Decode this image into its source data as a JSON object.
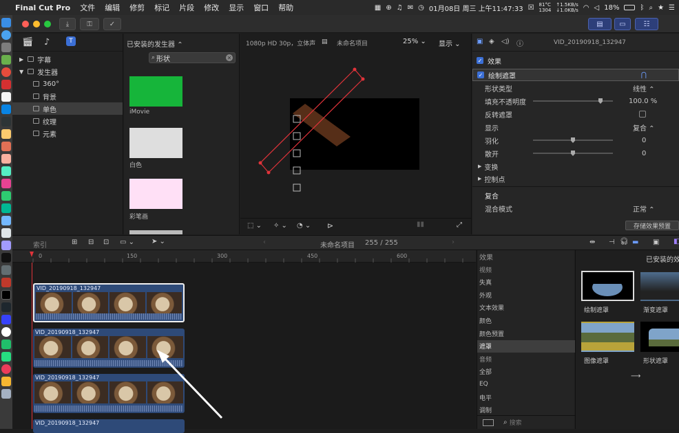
{
  "menubar": {
    "app": "Final Cut Pro",
    "items": [
      "文件",
      "编辑",
      "修剪",
      "标记",
      "片段",
      "修改",
      "显示",
      "窗口",
      "帮助"
    ],
    "datetime": "01月08日 周三 上午11:47:33",
    "temp": "81°C",
    "fan": "1304",
    "net_up": "↑1.5KB/s",
    "net_down": "↓1.0KB/s",
    "battery": "18%"
  },
  "library": {
    "items": [
      {
        "label": "字幕",
        "level": 0
      },
      {
        "label": "发生器",
        "level": 0
      },
      {
        "label": "360°",
        "level": 1
      },
      {
        "label": "背景",
        "level": 1
      },
      {
        "label": "单色",
        "level": 1,
        "selected": true
      },
      {
        "label": "纹理",
        "level": 1
      },
      {
        "label": "元素",
        "level": 1
      }
    ]
  },
  "browser": {
    "title": "已安装的发生器",
    "search_value": "形状",
    "thumbs": [
      {
        "label": "iMovie",
        "color": "#16b53a"
      },
      {
        "label": "白色",
        "color": "#dedede"
      },
      {
        "label": "彩笔画",
        "color": "#ffe0f6"
      }
    ]
  },
  "viewer": {
    "format": "1080p HD 30p，立体声",
    "project": "未命名项目",
    "zoom": "25%",
    "display": "显示"
  },
  "inspector": {
    "clip_name": "VID_20190918_132947",
    "effects_label": "效果",
    "draw_mask": "绘制遮罩",
    "rows": [
      {
        "label": "形状类型",
        "value": "线性"
      },
      {
        "label": "填充不透明度",
        "value": "100.0 %",
        "slider": 0.82
      },
      {
        "label": "反转遮罩",
        "value": ""
      },
      {
        "label": "显示",
        "value": "复合"
      },
      {
        "label": "羽化",
        "value": "0",
        "slider": 0.5
      },
      {
        "label": "散开",
        "value": "0",
        "slider": 0.5
      },
      {
        "label": "变换",
        "value": ""
      },
      {
        "label": "控制点",
        "value": ""
      }
    ],
    "composite_label": "复合",
    "blend_label": "混合模式",
    "blend_value": "正常",
    "save_preset": "存储效果预置"
  },
  "timeline_bar": {
    "index": "索引",
    "project": "未命名项目",
    "counter": "255 / 255"
  },
  "ruler": {
    "ticks": [
      "0",
      "150",
      "300",
      "450",
      "600"
    ]
  },
  "timeline": {
    "clips": [
      {
        "name": "VID_20190918_132947",
        "selected": true
      },
      {
        "name": "VID_20190918_132947",
        "selected": false
      },
      {
        "name": "VID_20190918_132947",
        "selected": false
      },
      {
        "name": "VID_20190918_132947",
        "selected": false
      }
    ]
  },
  "effects": {
    "header": "效果",
    "grid_header": "已安装的效",
    "categories": [
      "视频",
      "失真",
      "外观",
      "文本效果",
      "颜色",
      "颜色预置",
      "遮罩",
      "音频",
      "全部",
      "EQ",
      "电平",
      "调制"
    ],
    "selected_category": "遮罩",
    "search_placeholder": "搜索",
    "items": [
      {
        "label": "绘制遮罩",
        "selected": true
      },
      {
        "label": "渐变遮罩",
        "selected": false
      },
      {
        "label": "图像遮罩",
        "selected": false
      },
      {
        "label": "形状遮罩",
        "selected": false
      }
    ]
  },
  "colors": {
    "accent": "#3b6fd6",
    "clip": "#2e4a78",
    "mask_line": "#e0333a"
  }
}
